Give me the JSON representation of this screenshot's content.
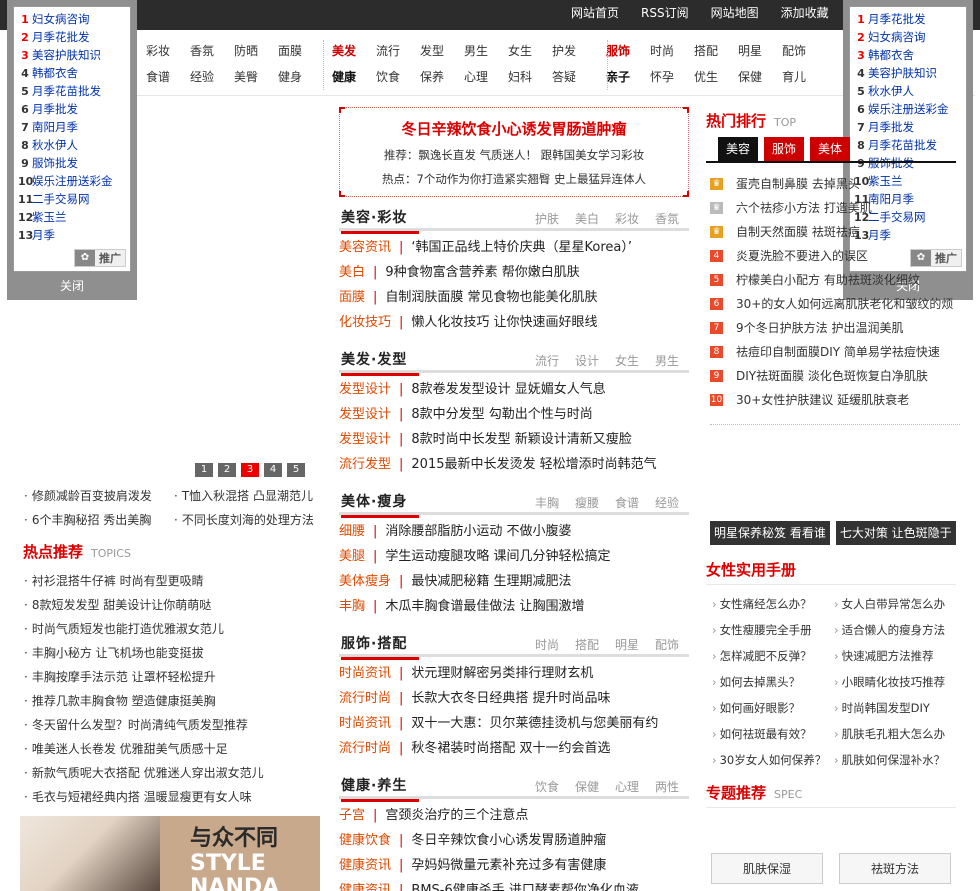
{
  "topnav": {
    "links": [
      "网站首页",
      "RSS订阅",
      "网站地图",
      "添加收藏"
    ]
  },
  "catnav": {
    "row1": [
      {
        "label": "彩妆",
        "style": ""
      },
      {
        "label": "香氛",
        "style": ""
      },
      {
        "label": "防晒",
        "style": ""
      },
      {
        "label": "面膜",
        "style": ""
      },
      {
        "label": "美发",
        "style": "hl"
      },
      {
        "label": "流行",
        "style": ""
      },
      {
        "label": "发型",
        "style": ""
      },
      {
        "label": "男生",
        "style": ""
      },
      {
        "label": "女生",
        "style": ""
      },
      {
        "label": "护发",
        "style": ""
      },
      {
        "label": "服饰",
        "style": "hl"
      },
      {
        "label": "时尚",
        "style": ""
      },
      {
        "label": "搭配",
        "style": ""
      },
      {
        "label": "明星",
        "style": ""
      },
      {
        "label": "配饰",
        "style": ""
      }
    ],
    "row2": [
      {
        "label": "食谱",
        "style": ""
      },
      {
        "label": "经验",
        "style": ""
      },
      {
        "label": "美臀",
        "style": ""
      },
      {
        "label": "健身",
        "style": ""
      },
      {
        "label": "健康",
        "style": "bk"
      },
      {
        "label": "饮食",
        "style": ""
      },
      {
        "label": "保养",
        "style": ""
      },
      {
        "label": "心理",
        "style": ""
      },
      {
        "label": "妇科",
        "style": ""
      },
      {
        "label": "答疑",
        "style": ""
      },
      {
        "label": "亲子",
        "style": "bk"
      },
      {
        "label": "怀孕",
        "style": ""
      },
      {
        "label": "优生",
        "style": ""
      },
      {
        "label": "保健",
        "style": ""
      },
      {
        "label": "育儿",
        "style": ""
      }
    ]
  },
  "rank_left": {
    "items": [
      "妇女病咨询",
      "月季花批发",
      "美容护肤知识",
      "韩都衣舍",
      "月季花苗批发",
      "月季批发",
      "南阳月季",
      "秋水伊人",
      "服饰批发",
      "娱乐注册送彩金",
      "二手交易网",
      "紫玉兰",
      "月季"
    ],
    "promo_label": "推广",
    "close_label": "关闭"
  },
  "rank_right": {
    "items": [
      "月季花批发",
      "妇女病咨询",
      "韩都衣舍",
      "美容护肤知识",
      "秋水伊人",
      "娱乐注册送彩金",
      "月季批发",
      "月季花苗批发",
      "服饰批发",
      "紫玉兰",
      "南阳月季",
      "二手交易网",
      "月季"
    ],
    "promo_label": "推广",
    "close_label": "关闭"
  },
  "slider": {
    "pages": [
      "1",
      "2",
      "3",
      "4",
      "5"
    ],
    "active": "3"
  },
  "left_links": [
    [
      "修颜减龄百变披肩泼发",
      "T恤入秋混搭 凸显潮范儿"
    ],
    [
      "6个丰胸秘招 秀出美胸",
      "不同长度刘海的处理方法"
    ]
  ],
  "hot": {
    "title": "热点推荐",
    "subtitle": "TOPICS",
    "items": [
      "衬衫混搭牛仔裤 时尚有型更吸睛",
      "8款短发发型 甜美设计让你萌萌哒",
      "时尚气质短发也能打造优雅淑女范儿",
      "丰胸小秘方 让飞机场也能变挺拔",
      "丰胸按摩手法示范 让罩杯轻松提升",
      "推荐几款丰胸食物 塑造健康挺美胸",
      "冬天留什么发型？时尚清纯气质发型推荐",
      "唯美迷人长卷发 优雅甜美气质感十足",
      "新款气质呢大衣搭配 优雅迷人穿出淑女范儿",
      "毛衣与短裙经典内搭 温暖显瘦更有女人味"
    ]
  },
  "ad": {
    "line1": "与众不同",
    "line2": "STYLE",
    "line3": "NANDA"
  },
  "headline": {
    "title": "冬日辛辣饮食小心诱发胃肠道肿瘤",
    "line1": "推荐：飘逸长直发 气质迷人！ 跟韩国美女学习彩妆",
    "line2": "热点：7个动作为你打造紧实翘臀 史上最猛异连体人"
  },
  "mid_sections": [
    {
      "title": "美容·彩妆",
      "tags": [
        "护肤",
        "美白",
        "彩妆",
        "香氛"
      ],
      "items": [
        {
          "cat": "美容资讯",
          "text": "‘韩国正品线上特价庆典（星星Korea）’"
        },
        {
          "cat": "美白",
          "text": "9种食物富含营养素 帮你嫩白肌肤"
        },
        {
          "cat": "面膜",
          "text": "自制润肤面膜 常见食物也能美化肌肤"
        },
        {
          "cat": "化妆技巧",
          "text": "懒人化妆技巧 让你快速画好眼线"
        }
      ]
    },
    {
      "title": "美发·发型",
      "tags": [
        "流行",
        "设计",
        "女生",
        "男生"
      ],
      "items": [
        {
          "cat": "发型设计",
          "text": "8款卷发发型设计 显妩媚女人气息"
        },
        {
          "cat": "发型设计",
          "text": "8款中分发型 勾勒出个性与时尚"
        },
        {
          "cat": "发型设计",
          "text": "8款时尚中长发型 新颖设计清新又瘦脸"
        },
        {
          "cat": "流行发型",
          "text": "2015最新中长发烫发 轻松增添时尚韩范气"
        }
      ]
    },
    {
      "title": "美体·瘦身",
      "tags": [
        "丰胸",
        "瘦腰",
        "食谱",
        "经验"
      ],
      "items": [
        {
          "cat": "细腰",
          "text": "消除腰部脂肪小运动 不做小腹婆"
        },
        {
          "cat": "美腿",
          "text": "学生运动瘦腿攻略 课间几分钟轻松搞定"
        },
        {
          "cat": "美体瘦身",
          "text": "最快减肥秘籍 生理期减肥法"
        },
        {
          "cat": "丰胸",
          "text": "木瓜丰胸食谱最佳做法 让胸围激增"
        }
      ]
    },
    {
      "title": "服饰·搭配",
      "tags": [
        "时尚",
        "搭配",
        "明星",
        "配饰"
      ],
      "items": [
        {
          "cat": "时尚资讯",
          "text": "状元理财解密另类排行理财玄机"
        },
        {
          "cat": "流行时尚",
          "text": "长款大衣冬日经典搭 提升时尚品味"
        },
        {
          "cat": "时尚资讯",
          "text": "双十一大惠：贝尔莱德挂烫机与您美丽有约"
        },
        {
          "cat": "流行时尚",
          "text": "秋冬裙装时尚搭配 双十一约会首选"
        }
      ]
    },
    {
      "title": "健康·养生",
      "tags": [
        "饮食",
        "保健",
        "心理",
        "两性"
      ],
      "items": [
        {
          "cat": "子宫",
          "text": "宫颈炎治疗的三个注意点"
        },
        {
          "cat": "健康饮食",
          "text": "冬日辛辣饮食小心诱发胃肠道肿瘤"
        },
        {
          "cat": "健康资讯",
          "text": "孕妈妈微量元素补充过多有害健康"
        },
        {
          "cat": "健康资讯",
          "text": "BMS-6健康杀手 进口酵素帮你净化血液"
        }
      ]
    }
  ],
  "hotrank": {
    "title": "热门排行",
    "subtitle": "TOP",
    "tabs": [
      "美容",
      "服饰",
      "美体"
    ],
    "active_tab": "美容",
    "items": [
      {
        "badge": "",
        "kind": "crown",
        "text": "蛋壳自制鼻膜 去掉黑头"
      },
      {
        "badge": "",
        "kind": "crown2",
        "text": "六个祛疹小方法 打造美肌"
      },
      {
        "badge": "",
        "kind": "crown",
        "text": "自制天然面膜 祛斑祛痘"
      },
      {
        "badge": "4",
        "kind": "num",
        "text": "炎夏洗脸不要进入的误区"
      },
      {
        "badge": "5",
        "kind": "num",
        "text": "柠檬美白小配方 有助祛斑淡化细纹"
      },
      {
        "badge": "6",
        "kind": "num",
        "text": "30+的女人如何远离肌肤老化和皱纹的烦"
      },
      {
        "badge": "7",
        "kind": "num",
        "text": "9个冬日护肤方法 护出温润美肌"
      },
      {
        "badge": "8",
        "kind": "num",
        "text": "祛痘印自制面膜DIY 简单易学祛痘快速"
      },
      {
        "badge": "9",
        "kind": "num",
        "text": "DIY祛斑面膜 淡化色斑恢复白净肌肤"
      },
      {
        "badge": "10",
        "kind": "num",
        "text": "30+女性护肤建议 延缓肌肤衰老"
      }
    ]
  },
  "black_buttons": [
    "明星保养秘笈 看看谁",
    "七大对策 让色斑隐于"
  ],
  "women": {
    "title": "女性实用手册",
    "items": [
      "女性痛经怎么办？",
      "女人白带异常怎么办",
      "女性瘦腰完全手册",
      "适合懒人的瘦身方法",
      "怎样减肥不反弹？",
      "快速减肥方法推荐",
      "如何去掉黑头？",
      "小眼睛化妆技巧推荐",
      "如何画好眼影？",
      "时尚韩国发型DIY",
      "如何祛斑最有效？",
      "肌肤毛孔粗大怎么办",
      "30岁女人如何保养？",
      "肌肤如何保湿补水？"
    ]
  },
  "spec": {
    "title": "专题推荐",
    "subtitle": "SPEC",
    "buttons": [
      "肌肤保湿",
      "祛斑方法"
    ]
  }
}
